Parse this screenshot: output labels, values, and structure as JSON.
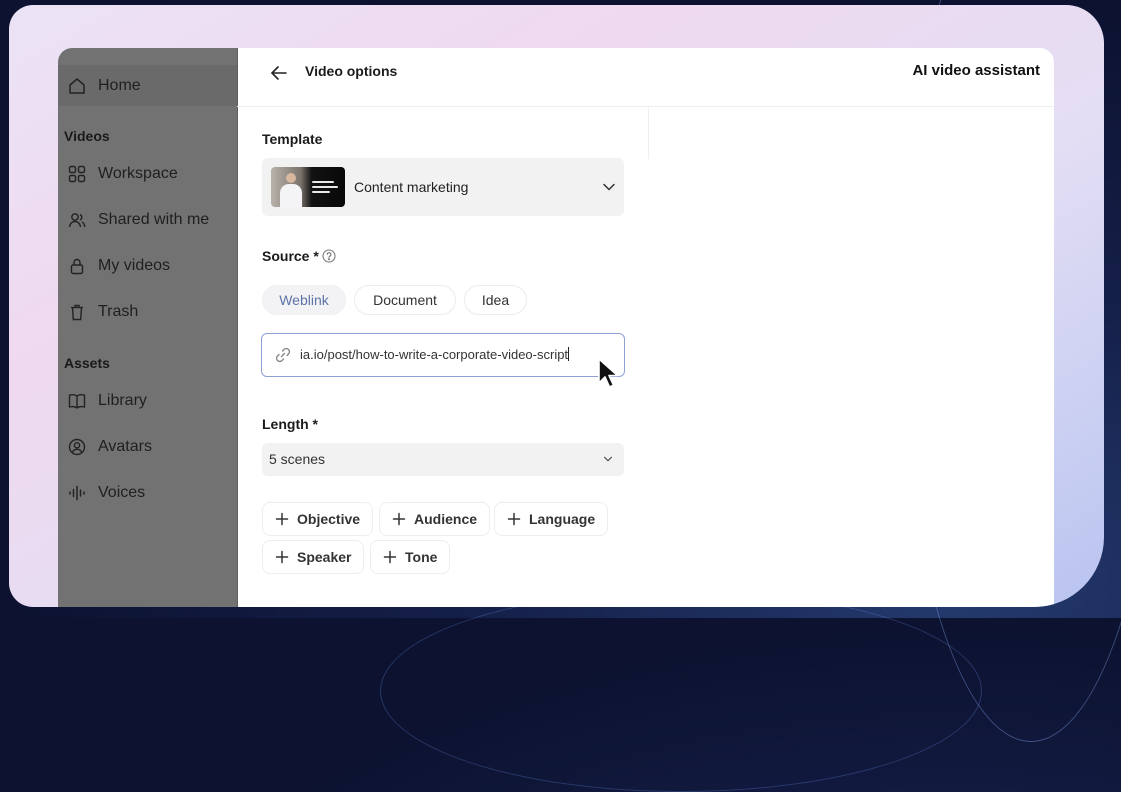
{
  "sidebar": {
    "home": {
      "label": "Home",
      "icon": "home-icon"
    },
    "sections": {
      "videos": "Videos",
      "assets": "Assets"
    },
    "video_items": [
      {
        "label": "Workspace",
        "icon": "grid-icon"
      },
      {
        "label": "Shared with me",
        "icon": "users-icon"
      },
      {
        "label": "My videos",
        "icon": "lock-icon"
      },
      {
        "label": "Trash",
        "icon": "trash-icon"
      }
    ],
    "asset_items": [
      {
        "label": "Library",
        "icon": "book-icon"
      },
      {
        "label": "Avatars",
        "icon": "avatar-icon"
      },
      {
        "label": "Voices",
        "icon": "waveform-icon"
      }
    ]
  },
  "header": {
    "title": "Video options",
    "assistant_title": "AI video assistant"
  },
  "form": {
    "template": {
      "label": "Template",
      "selected": "Content marketing"
    },
    "source": {
      "label": "Source *",
      "options": [
        "Weblink",
        "Document",
        "Idea"
      ],
      "active": "Weblink",
      "url_value": "ia.io/post/how-to-write-a-corporate-video-script"
    },
    "length": {
      "label": "Length *",
      "selected": "5 scenes"
    },
    "extras": [
      "Objective",
      "Audience",
      "Language",
      "Speaker",
      "Tone"
    ]
  },
  "colors": {
    "sidebar_overlay": "#727272",
    "accent_blue": "#5d73a7",
    "input_border": "#8ea0d4",
    "select_bg": "#f2f2f2"
  }
}
